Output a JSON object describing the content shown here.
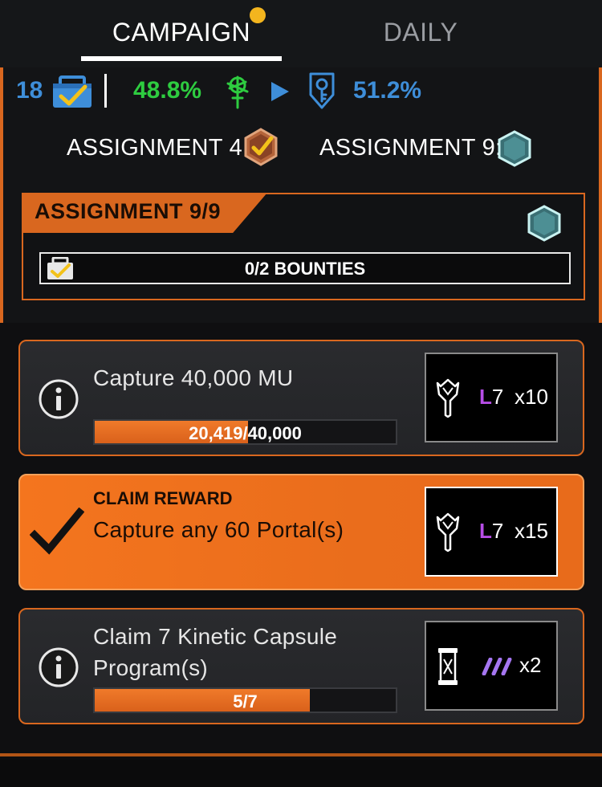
{
  "tabs": {
    "campaign": "CAMPAIGN",
    "daily": "DAILY"
  },
  "stats": {
    "count": "18",
    "enl_percent": "48.8%",
    "res_percent": "51.2%"
  },
  "assignments": {
    "current_label": "ASSIGNMENT 4:",
    "next_label": "ASSIGNMENT 9:"
  },
  "assignment_box": {
    "title": "ASSIGNMENT 9/9",
    "bounties": "0/2 BOUNTIES"
  },
  "tasks": [
    {
      "title": "Capture 40,000 MU",
      "progress_done": "20,419",
      "progress_total": "40,000",
      "progress_fraction": 0.51,
      "reward_level_letter": "L",
      "reward_level_num": "7",
      "reward_qty": "x10"
    },
    {
      "claim_label": "CLAIM REWARD",
      "title": "Capture any 60 Portal(s)",
      "reward_level_letter": "L",
      "reward_level_num": "7",
      "reward_qty": "x15"
    },
    {
      "title": "Claim 7 Kinetic Capsule Program(s)",
      "progress_text": "5/7",
      "progress_fraction": 0.714,
      "reward_qty": "x2"
    }
  ],
  "colors": {
    "accent_orange": "#d9671f",
    "enl_green": "#2ecc40",
    "res_blue": "#3e8ed9",
    "level_purple": "#b64de6",
    "notification_dot": "#f3b51e"
  },
  "icons": [
    "briefcase-icon",
    "enlightened-icon",
    "arrow-right-icon",
    "resistance-icon",
    "medal-icon",
    "hexagon-icon",
    "info-icon",
    "checkmark-icon",
    "xmp-burster-icon",
    "kinetic-capsule-icon"
  ]
}
